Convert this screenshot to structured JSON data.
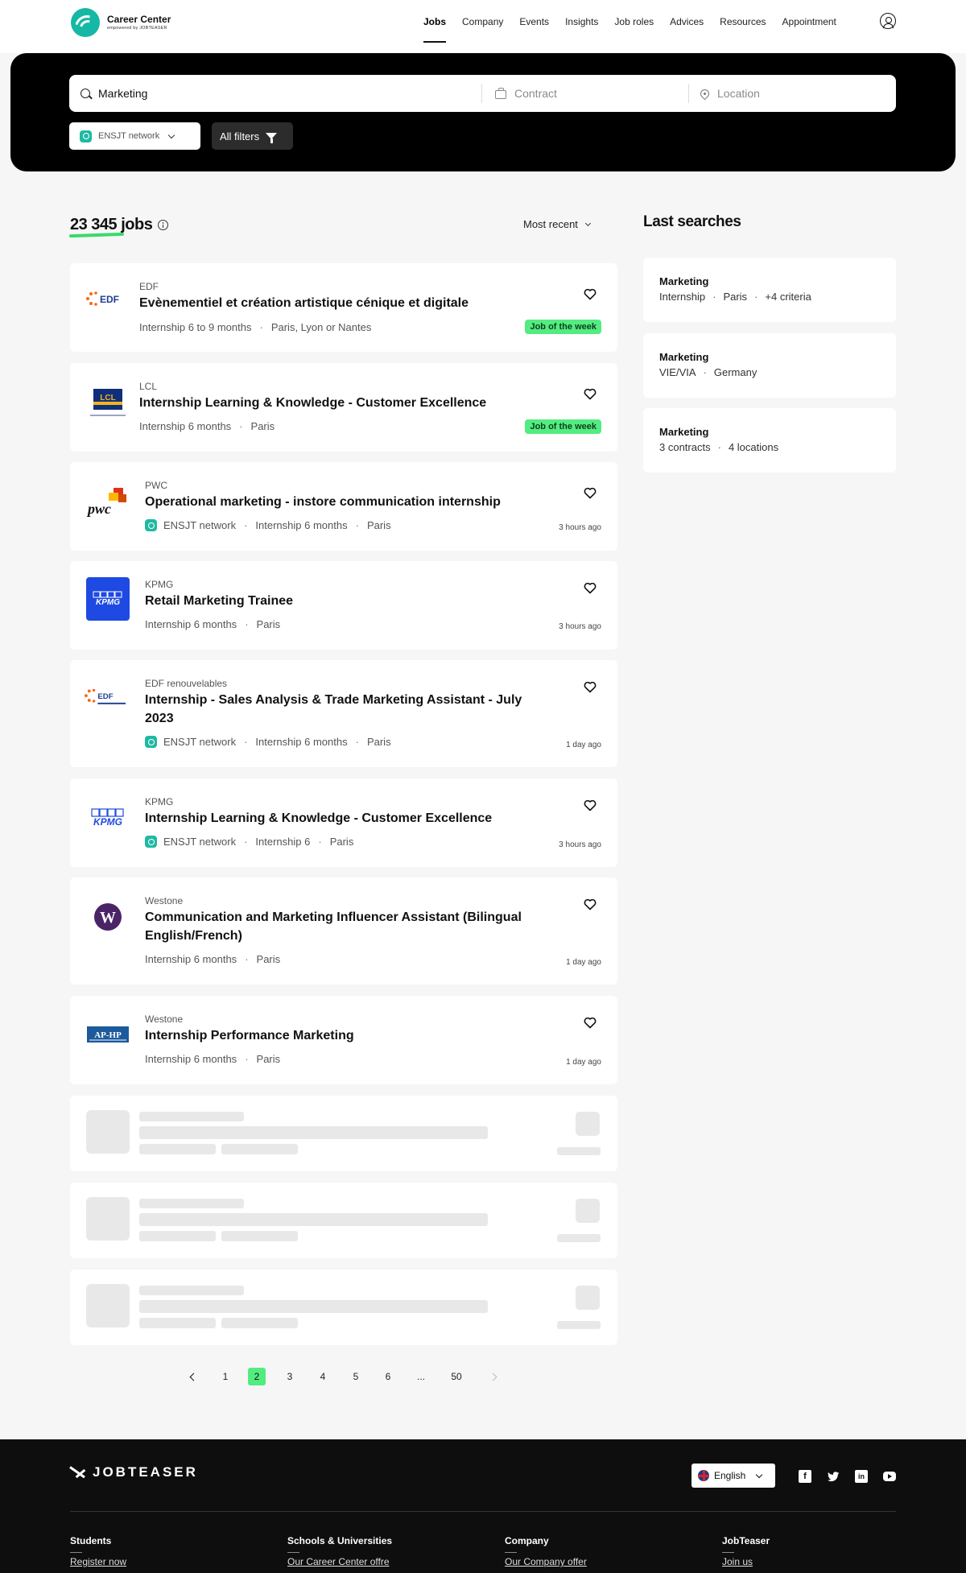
{
  "brand": {
    "title": "Career Center",
    "subtitle": "empowered by JOBTEASER"
  },
  "nav": {
    "items": [
      "Jobs",
      "Company",
      "Events",
      "Insights",
      "Job roles",
      "Advices",
      "Resources",
      "Appointment"
    ],
    "active": "Jobs"
  },
  "search": {
    "keyword_value": "Marketing",
    "contract_placeholder": "Contract",
    "location_placeholder": "Location",
    "network_filter": "ENSJT network",
    "all_filters": "All filters"
  },
  "results": {
    "count": "23 345 jobs",
    "sort": "Most recent"
  },
  "jobs": [
    {
      "company": "EDF",
      "title": "Evènementiel et création artistique cénique et digitale",
      "network": "",
      "contract": "Internship 6 to 9 months",
      "location": "Paris, Lyon or Nantes",
      "badge": "Job of the week",
      "posted": ""
    },
    {
      "company": "LCL",
      "title": "Internship Learning & Knowledge - Customer Excellence",
      "network": "",
      "contract": "Internship 6 months",
      "location": "Paris",
      "badge": "Job of the week",
      "posted": ""
    },
    {
      "company": "PWC",
      "title": "Operational marketing - instore communication internship",
      "network": "ENSJT network",
      "contract": "Internship 6 months",
      "location": "Paris",
      "badge": "",
      "posted": "3 hours ago"
    },
    {
      "company": "KPMG",
      "title": "Retail Marketing Trainee",
      "network": "",
      "contract": "Internship 6 months",
      "location": "Paris",
      "badge": "",
      "posted": "3 hours ago"
    },
    {
      "company": "EDF renouvelables",
      "title": "Internship - Sales Analysis & Trade Marketing Assistant - July 2023",
      "network": "ENSJT network",
      "contract": "Internship 6 months",
      "location": "Paris",
      "badge": "",
      "posted": "1 day ago"
    },
    {
      "company": "KPMG",
      "title": "Internship Learning & Knowledge - Customer Excellence",
      "network": "ENSJT network",
      "contract": "Internship 6",
      "location": "Paris",
      "badge": "",
      "posted": "3 hours ago"
    },
    {
      "company": "Westone",
      "title": "Communication and Marketing Influencer Assistant (Bilingual English/French)",
      "network": "",
      "contract": "Internship 6 months",
      "location": "Paris",
      "badge": "",
      "posted": "1 day ago"
    },
    {
      "company": "Westone",
      "title": "Internship Performance Marketing",
      "network": "",
      "contract": "Internship 6 months",
      "location": "Paris",
      "badge": "",
      "posted": "1 day ago"
    }
  ],
  "logos": {
    "edf": "EDF",
    "lcl": "LCL",
    "pwc": "pwc",
    "kpmg": "KPMG",
    "edf_renew": "EDF",
    "westone": "W",
    "aphp": "AP-HP"
  },
  "last_searches": {
    "title": "Last searches",
    "items": [
      {
        "keyword": "Marketing",
        "criteria": [
          "Internship",
          "Paris",
          "+4 criteria"
        ]
      },
      {
        "keyword": "Marketing",
        "criteria": [
          "VIE/VIA",
          "Germany"
        ]
      },
      {
        "keyword": "Marketing",
        "criteria": [
          "3 contracts",
          "4 locations"
        ]
      }
    ]
  },
  "pagination": {
    "pages": [
      "1",
      "2",
      "3",
      "4",
      "5",
      "6",
      "...",
      "50"
    ],
    "current": "2"
  },
  "footer": {
    "logo": "JOBTEASER",
    "language": "English",
    "columns": [
      {
        "title": "Students",
        "link": "Register now"
      },
      {
        "title": "Schools & Universities",
        "link": "Our Career Center offre"
      },
      {
        "title": "Company",
        "link": "Our Company offer"
      },
      {
        "title": "JobTeaser",
        "link": "Join us"
      }
    ]
  },
  "colors": {
    "accent_green": "#53ec80",
    "network_teal": "#1fb9a3",
    "band_black": "#000000",
    "kpmg_blue": "#1e49e2"
  }
}
